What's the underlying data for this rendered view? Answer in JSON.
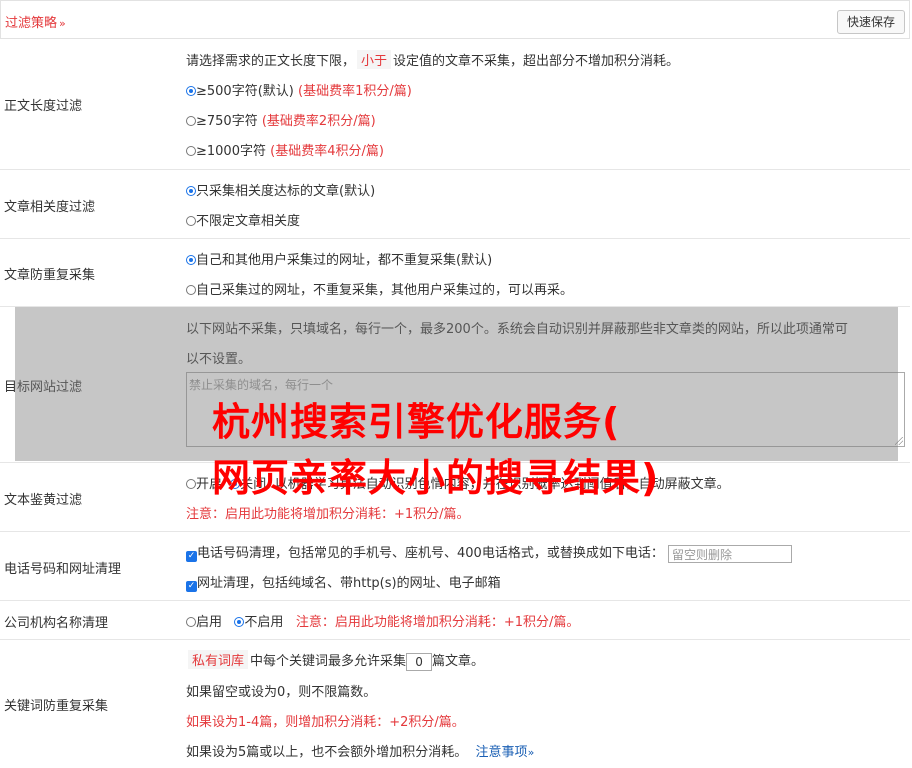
{
  "header": {
    "title": "过滤策略",
    "chevron": "»",
    "save_label": "快速保存"
  },
  "length_filter": {
    "label": "正文长度过滤",
    "desc_pre": "请选择需求的正文长度下限，",
    "desc_tag": "小于",
    "desc_post": "设定值的文章不采集，超出部分不增加积分消耗。",
    "options": [
      {
        "text": "≥500字符(默认)",
        "note": "(基础费率1积分/篇)",
        "checked": true
      },
      {
        "text": "≥750字符",
        "note": "(基础费率2积分/篇)",
        "checked": false
      },
      {
        "text": "≥1000字符",
        "note": "(基础费率4积分/篇)",
        "checked": false
      }
    ]
  },
  "relevance_filter": {
    "label": "文章相关度过滤",
    "options": [
      {
        "text": "只采集相关度达标的文章(默认)",
        "checked": true
      },
      {
        "text": "不限定文章相关度",
        "checked": false
      }
    ]
  },
  "duplicate_filter": {
    "label": "文章防重复采集",
    "options": [
      {
        "text": "自己和其他用户采集过的网址，都不重复采集(默认)",
        "checked": true
      },
      {
        "text": "自己采集过的网址，不重复采集，其他用户采集过的，可以再采。",
        "checked": false
      }
    ]
  },
  "site_filter": {
    "label": "目标网站过滤",
    "desc_line1": "以下网站不采集，只填域名，每行一个，最多200个。系统会自动识别并屏蔽那些非文章类的网站，所以此项通常可",
    "desc_line2": "以不设置。",
    "placeholder": "禁止采集的域名，每行一个"
  },
  "watermark": {
    "line1": "杭州搜索引擎优化服务(",
    "line2": "网页亲率大小的搜寻结果)"
  },
  "porn_filter": {
    "label": "文本鉴黄过滤",
    "opt_on": "开启",
    "opt_off": "关闭",
    "desc": "以机器学习算法自动识别色情内容，并在识别概率达到阈值后，自动屏蔽文章。",
    "note": "注意：启用此功能将增加积分消耗：+1积分/篇。"
  },
  "phone_filter": {
    "label": "电话号码和网址清理",
    "phone_text": "电话号码清理，包括常见的手机号、座机号、400电话格式，或替换成如下电话：",
    "phone_placeholder": "留空则删除",
    "url_text": "网址清理，包括纯域名、带http(s)的网址、电子邮箱"
  },
  "company_filter": {
    "label": "公司机构名称清理",
    "opt_on": "启用",
    "opt_off": "不启用",
    "note": "注意：启用此功能将增加积分消耗：+1积分/篇。"
  },
  "keyword_filter": {
    "label": "关键词防重复采集",
    "tag": "私有词库",
    "line1_mid": "中每个关键词最多允许采集",
    "value": "0",
    "line1_post": "篇文章。",
    "line2": "如果留空或设为0，则不限篇数。",
    "line3": "如果设为1-4篇，则增加积分消耗：+2积分/篇。",
    "line4": "如果设为5篇或以上，也不会额外增加积分消耗。",
    "link": "注意事项",
    "link_chevron": "»"
  },
  "colors": {
    "accent_red": "#e4393c",
    "radio_blue": "#1a73e8"
  }
}
